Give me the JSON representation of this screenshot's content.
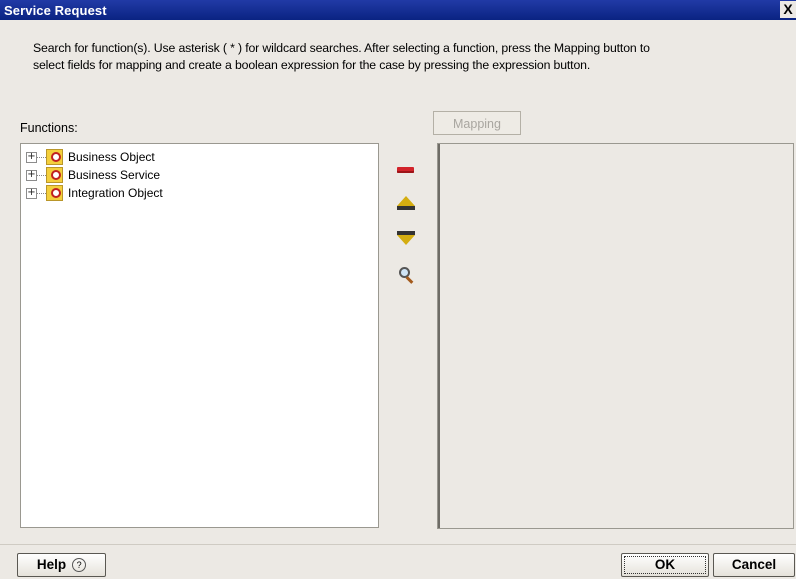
{
  "window": {
    "title": "Service Request",
    "close_glyph": "X"
  },
  "instructions": "Search for function(s). Use asterisk ( * ) for wildcard searches. After selecting a function, press the Mapping button to\nselect fields for mapping and create a boolean expression for the case by pressing the expression button.",
  "functions": {
    "label": "Functions:",
    "items": [
      {
        "label": "Business Object",
        "expander": "+",
        "icon": "business-object-icon"
      },
      {
        "label": "Business Service",
        "expander": "+",
        "icon": "business-service-icon"
      },
      {
        "label": "Integration Object",
        "expander": "+",
        "icon": "integration-object-icon"
      }
    ]
  },
  "toolbar": {
    "icons": [
      "remove-icon",
      "move-up-icon",
      "move-down-icon",
      "search-icon"
    ]
  },
  "mapping": {
    "button_label": "Mapping",
    "enabled": false
  },
  "footer": {
    "help_label": "Help",
    "help_icon_glyph": "?",
    "ok_label": "OK",
    "cancel_label": "Cancel"
  },
  "colors": {
    "titlebar": "#0a2382",
    "dialog_bg": "#ece9e4",
    "remove_red": "#d2232a",
    "arrow_gold": "#d4ad10"
  }
}
